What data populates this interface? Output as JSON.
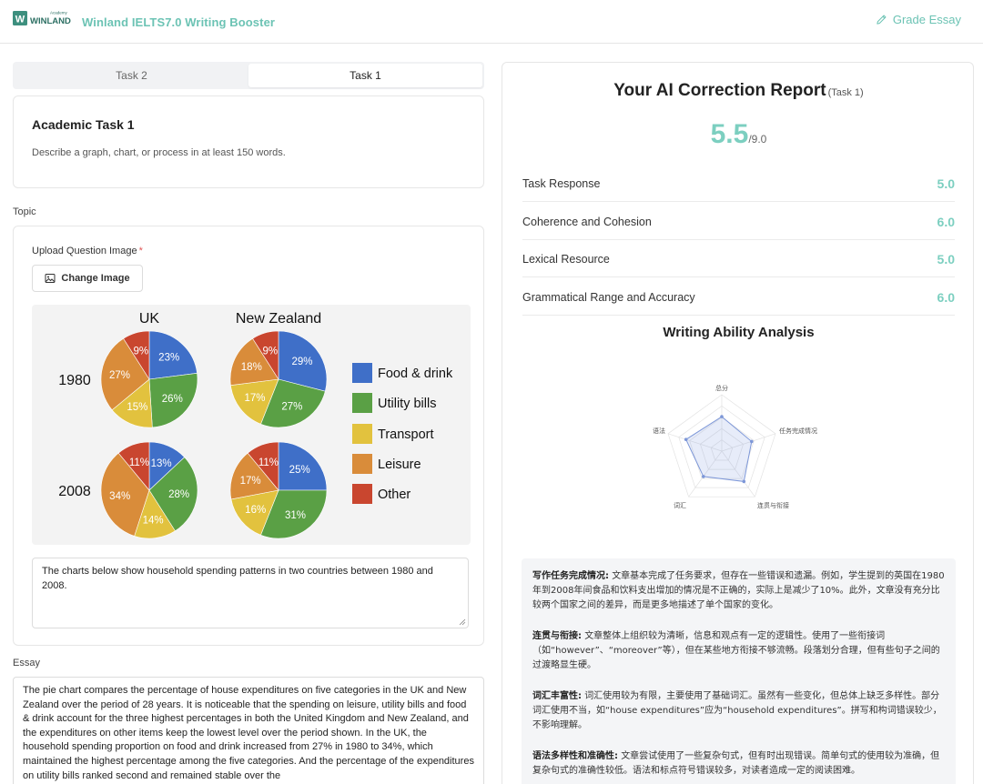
{
  "header": {
    "logo_text": "WINLAND",
    "logo_sub": "Academy",
    "app_title": "Winland IELTS7.0 Writing Booster",
    "grade_label": "Grade Essay"
  },
  "tabs": [
    {
      "label": "Task 2",
      "active": false
    },
    {
      "label": "Task 1",
      "active": true
    }
  ],
  "task": {
    "title": "Academic Task 1",
    "description": "Describe a graph, chart, or process in at least 150 words."
  },
  "topic": {
    "section_label": "Topic",
    "upload_label": "Upload Question Image",
    "required_mark": "*",
    "change_image_label": "Change Image",
    "description_value": "The charts below show household spending patterns in two countries between 1980 and 2008."
  },
  "question_image": {
    "col_labels": [
      "UK",
      "New Zealand"
    ],
    "row_labels": [
      "1980",
      "2008"
    ],
    "legend": [
      {
        "label": "Food & drink",
        "color": "#3f6fc8"
      },
      {
        "label": "Utility bills",
        "color": "#5aa045"
      },
      {
        "label": "Transport",
        "color": "#e2c23e"
      },
      {
        "label": "Leisure",
        "color": "#d98c3a"
      },
      {
        "label": "Other",
        "color": "#c9462f"
      }
    ],
    "pies": [
      {
        "id": "uk-1980",
        "values": [
          23,
          26,
          15,
          27,
          9
        ],
        "labels": [
          "23%",
          "26%",
          "15%",
          "27%",
          "9%"
        ]
      },
      {
        "id": "nz-1980",
        "values": [
          29,
          27,
          17,
          18,
          9
        ],
        "labels": [
          "29%",
          "27%",
          "17%",
          "18%",
          "9%"
        ]
      },
      {
        "id": "uk-2008",
        "values": [
          13,
          28,
          14,
          34,
          11
        ],
        "labels": [
          "13%",
          "28%",
          "14%",
          "34%",
          "11%"
        ]
      },
      {
        "id": "nz-2008",
        "values": [
          25,
          31,
          16,
          17,
          11
        ],
        "labels": [
          "25%",
          "31%",
          "16%",
          "17%",
          "11%"
        ]
      }
    ]
  },
  "essay": {
    "section_label": "Essay",
    "text": "The pie chart compares the percentage of house expenditures on five categories in the UK and New Zealand over the period of 28 years. It is noticeable that the spending on leisure, utility bills and food & drink account for the three highest percentages in both the United Kingdom and New Zealand, and the expenditures on other items keep the lowest level over the period shown. In the UK, the household spending proportion on food and drink increased from 27% in 1980 to 34%, which maintained the highest percentage among the five categories. And the percentage of the expenditures on utility bills ranked second and remained stable over the"
  },
  "report": {
    "title": "Your AI Correction Report",
    "task_tag": "(Task 1)",
    "overall_score": "5.5",
    "overall_max": "/9.0",
    "criteria": [
      {
        "name": "Task Response",
        "score": "5.0"
      },
      {
        "name": "Coherence and Cohesion",
        "score": "6.0"
      },
      {
        "name": "Lexical Resource",
        "score": "5.0"
      },
      {
        "name": "Grammatical Range and Accuracy",
        "score": "6.0"
      }
    ],
    "analysis_title": "Writing Ability Analysis",
    "radar": {
      "axes": [
        "总分",
        "任务完成情况",
        "连贯与衔接",
        "词汇",
        "语法"
      ],
      "values": [
        5.5,
        5.0,
        6.0,
        5.0,
        6.0
      ],
      "max": 9
    },
    "feedback": [
      {
        "heading": "写作任务完成情况:",
        "text": "文章基本完成了任务要求，但存在一些错误和遗漏。例如，学生提到的英国在1980年到2008年间食品和饮料支出增加的情况是不正确的，实际上是减少了10%。此外，文章没有充分比较两个国家之间的差异，而是更多地描述了单个国家的变化。"
      },
      {
        "heading": "连贯与衔接:",
        "text": "文章整体上组织较为清晰，信息和观点有一定的逻辑性。使用了一些衔接词（如“however”、“moreover”等），但在某些地方衔接不够流畅。段落划分合理，但有些句子之间的过渡略显生硬。"
      },
      {
        "heading": "词汇丰富性:",
        "text": "词汇使用较为有限，主要使用了基础词汇。虽然有一些变化，但总体上缺乏多样性。部分词汇使用不当，如“house expenditures”应为“household expenditures”。拼写和构词错误较少，不影响理解。"
      },
      {
        "heading": "语法多样性和准确性:",
        "text": "文章尝试使用了一些复杂句式，但有时出现错误。简单句式的使用较为准确，但复杂句式的准确性较低。语法和标点符号错误较多，对读者造成一定的阅读困难。"
      }
    ]
  }
}
